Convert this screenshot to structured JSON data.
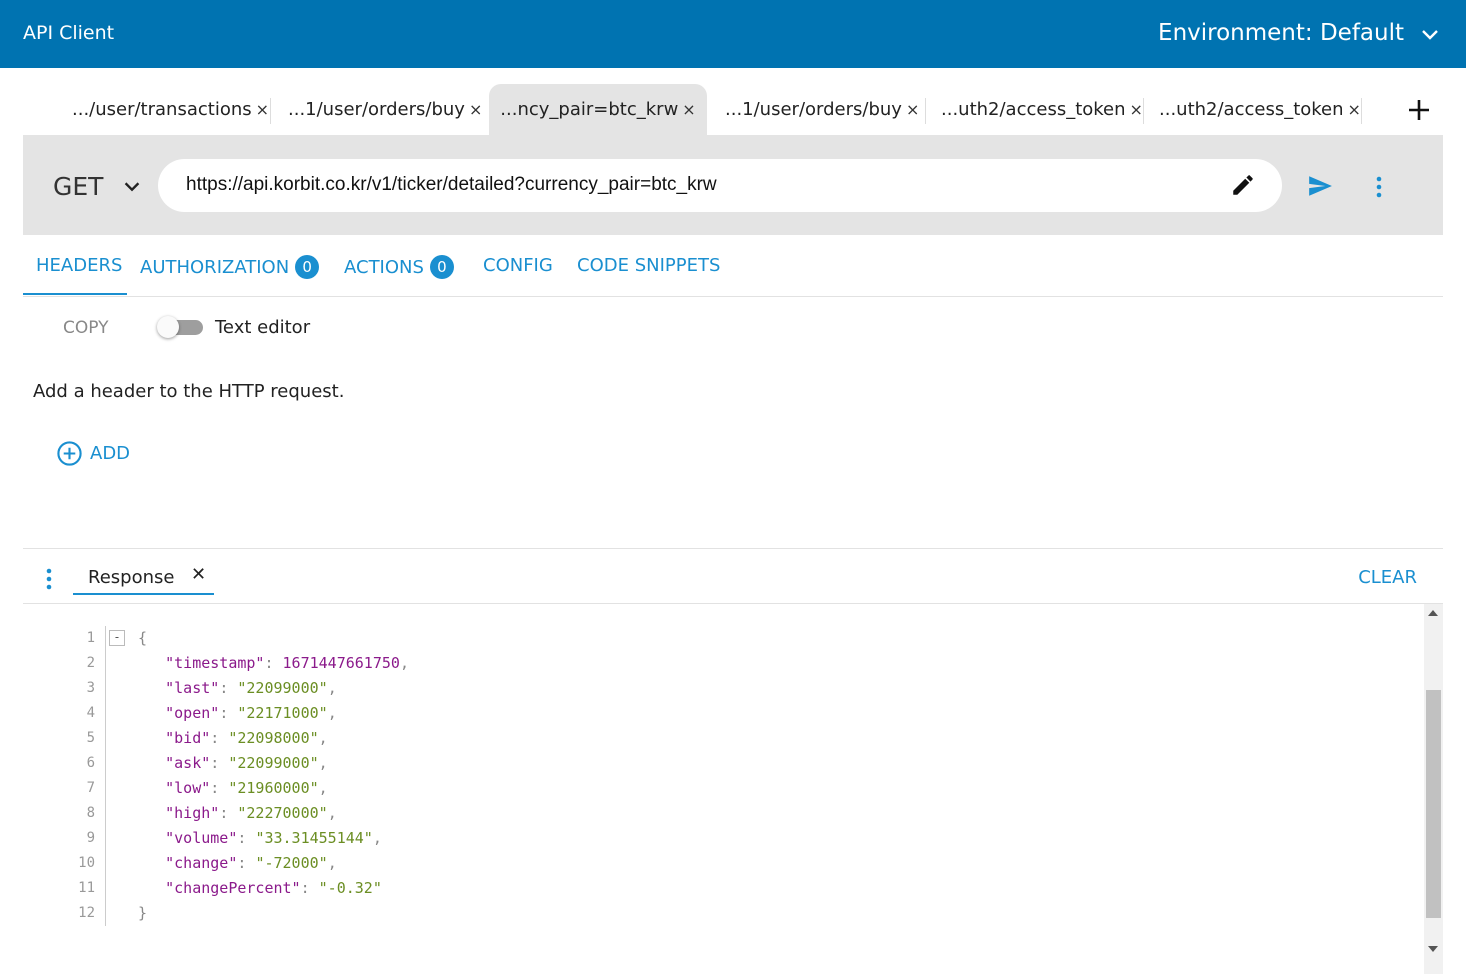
{
  "app": {
    "title": "API Client",
    "environment_label": "Environment: Default",
    "accent": "#0073b1",
    "link_color": "#1a8fd0"
  },
  "tabs": [
    {
      "label": ".../user/transactions",
      "active": false
    },
    {
      "label": "...1/user/orders/buy",
      "active": false
    },
    {
      "label": "...ncy_pair=btc_krw",
      "active": true
    },
    {
      "label": "...1/user/orders/buy",
      "active": false
    },
    {
      "label": "...uth2/access_token",
      "active": false
    },
    {
      "label": "...uth2/access_token",
      "active": false
    }
  ],
  "tab_close_glyph": "×",
  "request": {
    "method": "GET",
    "url": "https://api.korbit.co.kr/v1/ticker/detailed?currency_pair=btc_krw"
  },
  "subtabs": [
    {
      "label": "HEADERS",
      "badge": null
    },
    {
      "label": "AUTHORIZATION",
      "badge": "0"
    },
    {
      "label": "ACTIONS",
      "badge": "0"
    },
    {
      "label": "CONFIG",
      "badge": null
    },
    {
      "label": "CODE SNIPPETS",
      "badge": null
    }
  ],
  "headers_panel": {
    "copy_label": "COPY",
    "toggle_label": "Text editor",
    "toggle_on": false,
    "hint": "Add a header to the HTTP request.",
    "add_label": "ADD"
  },
  "response": {
    "tab_label": "Response",
    "close_glyph": "✕",
    "clear_label": "CLEAR",
    "line_numbers": [
      "1",
      "2",
      "3",
      "4",
      "5",
      "6",
      "7",
      "8",
      "9",
      "10",
      "11",
      "12"
    ],
    "fields": [
      {
        "key": "\"timestamp\"",
        "value": "1671447661750",
        "type": "number"
      },
      {
        "key": "\"last\"",
        "value": "\"22099000\"",
        "type": "string"
      },
      {
        "key": "\"open\"",
        "value": "\"22171000\"",
        "type": "string"
      },
      {
        "key": "\"bid\"",
        "value": "\"22098000\"",
        "type": "string"
      },
      {
        "key": "\"ask\"",
        "value": "\"22099000\"",
        "type": "string"
      },
      {
        "key": "\"low\"",
        "value": "\"21960000\"",
        "type": "string"
      },
      {
        "key": "\"high\"",
        "value": "\"22270000\"",
        "type": "string"
      },
      {
        "key": "\"volume\"",
        "value": "\"33.31455144\"",
        "type": "string"
      },
      {
        "key": "\"change\"",
        "value": "\"-72000\"",
        "type": "string"
      },
      {
        "key": "\"changePercent\"",
        "value": "\"-0.32\"",
        "type": "string"
      }
    ],
    "open_brace": "{",
    "close_brace": "}",
    "fold_glyph": "-"
  },
  "icons": {
    "env_dropdown": "chevron-down-icon",
    "add_tab": "plus-icon",
    "method_dropdown": "chevron-down-icon",
    "edit_url": "pencil-icon",
    "send": "send-icon",
    "more": "more-vertical-icon",
    "add_header": "add-circle-icon"
  }
}
